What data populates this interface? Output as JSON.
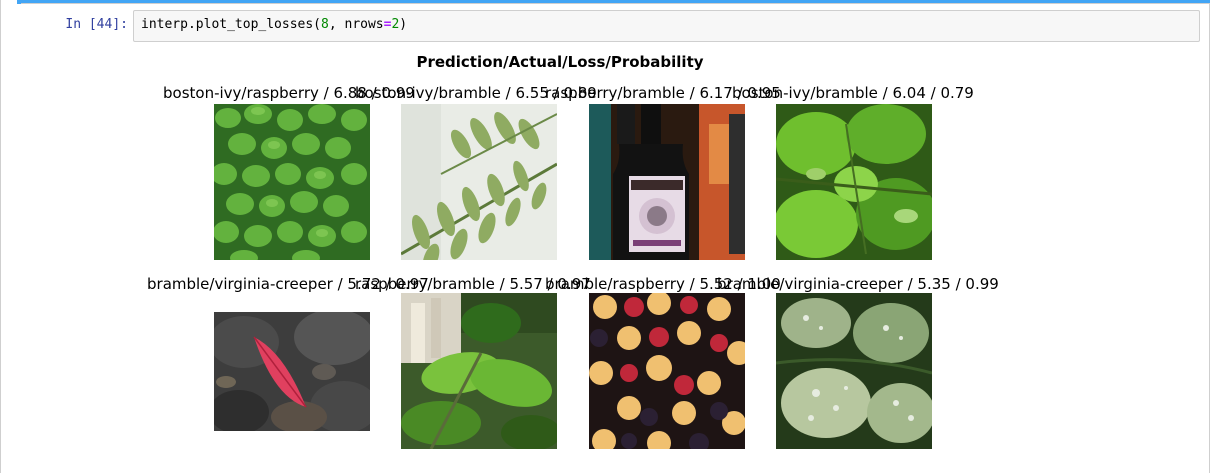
{
  "cell": {
    "prompt": "In [44]:",
    "code": {
      "fn": "interp.plot_top_losses(",
      "arg1": "8",
      "sep": ", nrows",
      "op": "=",
      "arg2": "2",
      "close": ")"
    }
  },
  "figure": {
    "title": "Prediction/Actual/Loss/Probability",
    "row1": [
      {
        "label": "boston-ivy/raspberry / 6.88 / 0.99",
        "image": "ivy-leaves-cluster"
      },
      {
        "label": "boston-ivy/bramble / 6.55 / 0.89",
        "image": "fern-frond"
      },
      {
        "label": "raspberry/bramble / 6.17 / 0.95",
        "image": "liquor-bottles"
      },
      {
        "label": "boston-ivy/bramble / 6.04 / 0.79",
        "image": "green-leaves-with-frog"
      }
    ],
    "row2": [
      {
        "label": "bramble/virginia-creeper / 5.72 / 0.97",
        "image": "red-leaf-on-rocks"
      },
      {
        "label": "raspberry/bramble / 5.57 / 0.97",
        "image": "green-leaves-stems"
      },
      {
        "label": "bramble/raspberry / 5.52 / 1.00",
        "image": "mixed-berries"
      },
      {
        "label": "bramble/virginia-creeper / 5.35 / 0.99",
        "image": "variegated-leaves"
      }
    ]
  },
  "colors": {
    "accent": "#42a5f5",
    "prompt": "#303f9f",
    "input_bg": "#f7f7f7"
  }
}
